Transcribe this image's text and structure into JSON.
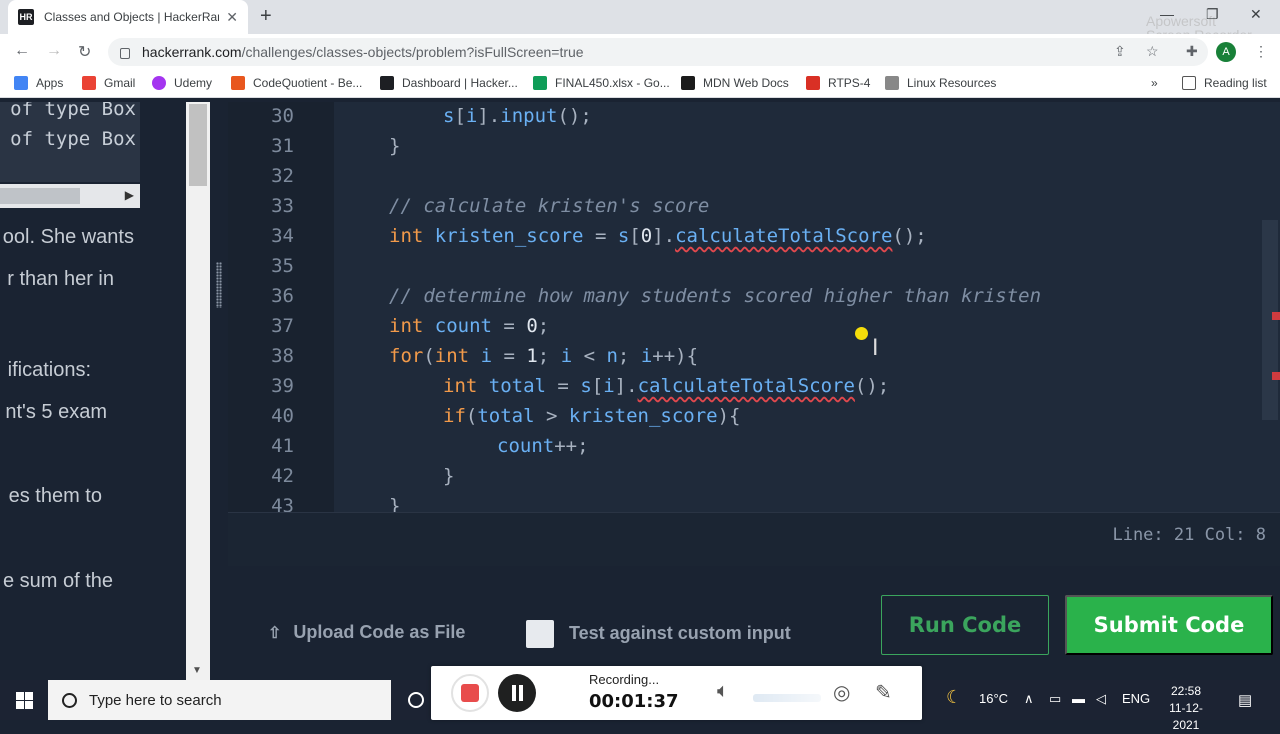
{
  "browser": {
    "tab_title": "Classes and Objects | HackerRank",
    "tab_favicon": "HR",
    "url_host": "hackerrank.com",
    "url_path": "/challenges/classes-objects/problem?isFullScreen=true",
    "avatar_letter": "A",
    "bookmarks": [
      {
        "label": "Apps",
        "icon": "apps-grid-icon",
        "color": "#4285f4"
      },
      {
        "label": "Gmail",
        "icon": "gmail-icon",
        "color": "#ea4335"
      },
      {
        "label": "Udemy",
        "icon": "udemy-icon",
        "color": "#a435f0"
      },
      {
        "label": "CodeQuotient - Be...",
        "icon": "codequotient-icon",
        "color": "#e8571e"
      },
      {
        "label": "Dashboard | Hacker...",
        "icon": "hackerrank-icon",
        "color": "#1d1f23"
      },
      {
        "label": "FINAL450.xlsx - Go...",
        "icon": "google-drive-icon",
        "color": "#0f9d58"
      },
      {
        "label": "MDN Web Docs",
        "icon": "mdn-icon",
        "color": "#1b1b1b"
      },
      {
        "label": "RTPS-4",
        "icon": "rtps-icon",
        "color": "#d93025"
      },
      {
        "label": "Linux Resources",
        "icon": "linux-icon",
        "color": "#888888"
      }
    ],
    "more_bookmarks": "»",
    "reading_list": "Reading list"
  },
  "problem": {
    "code_lines": [
      "l of type Box",
      " of type Box"
    ],
    "desc_lines": [
      "ool. She wants",
      "r than her in",
      "ifications:",
      "nt's 5 exam",
      "es them to",
      "e sum of the"
    ]
  },
  "editor": {
    "lines": [
      {
        "n": "30",
        "indent": 2,
        "tokens": [
          [
            "id",
            "s"
          ],
          [
            "p",
            "["
          ],
          [
            "id",
            "i"
          ],
          [
            "p",
            "]."
          ],
          [
            "id",
            "input"
          ],
          [
            "p",
            "();"
          ]
        ]
      },
      {
        "n": "31",
        "indent": 1,
        "tokens": [
          [
            "p",
            "}"
          ]
        ]
      },
      {
        "n": "32",
        "indent": 0,
        "tokens": []
      },
      {
        "n": "33",
        "indent": 1,
        "tokens": [
          [
            "cmt",
            "// calculate kristen's score"
          ]
        ]
      },
      {
        "n": "34",
        "indent": 1,
        "tokens": [
          [
            "kw",
            "int"
          ],
          [
            "p",
            " "
          ],
          [
            "id",
            "kristen_score"
          ],
          [
            "p",
            " = "
          ],
          [
            "id",
            "s"
          ],
          [
            "p",
            "["
          ],
          [
            "num",
            "0"
          ],
          [
            "p",
            "]."
          ],
          [
            "sq",
            "calculateTotalScore"
          ],
          [
            "p",
            "();"
          ]
        ]
      },
      {
        "n": "35",
        "indent": 0,
        "tokens": []
      },
      {
        "n": "36",
        "indent": 1,
        "tokens": [
          [
            "cmt",
            "// determine how many students scored higher than kristen"
          ]
        ]
      },
      {
        "n": "37",
        "indent": 1,
        "tokens": [
          [
            "kw",
            "int"
          ],
          [
            "p",
            " "
          ],
          [
            "id",
            "count"
          ],
          [
            "p",
            " = "
          ],
          [
            "num",
            "0"
          ],
          [
            "p",
            ";"
          ]
        ]
      },
      {
        "n": "38",
        "indent": 1,
        "tokens": [
          [
            "kw",
            "for"
          ],
          [
            "p",
            "("
          ],
          [
            "kw",
            "int"
          ],
          [
            "p",
            " "
          ],
          [
            "id",
            "i"
          ],
          [
            "p",
            " = "
          ],
          [
            "num",
            "1"
          ],
          [
            "p",
            "; "
          ],
          [
            "id",
            "i"
          ],
          [
            "p",
            " < "
          ],
          [
            "id",
            "n"
          ],
          [
            "p",
            "; "
          ],
          [
            "id",
            "i"
          ],
          [
            "p",
            "++){"
          ]
        ]
      },
      {
        "n": "39",
        "indent": 2,
        "tokens": [
          [
            "kw",
            "int"
          ],
          [
            "p",
            " "
          ],
          [
            "id",
            "total"
          ],
          [
            "p",
            " = "
          ],
          [
            "id",
            "s"
          ],
          [
            "p",
            "["
          ],
          [
            "id",
            "i"
          ],
          [
            "p",
            "]."
          ],
          [
            "sq",
            "calculateTotalScore"
          ],
          [
            "p",
            "();"
          ]
        ]
      },
      {
        "n": "40",
        "indent": 2,
        "tokens": [
          [
            "kw",
            "if"
          ],
          [
            "p",
            "("
          ],
          [
            "id",
            "total"
          ],
          [
            "p",
            " > "
          ],
          [
            "id",
            "kristen_score"
          ],
          [
            "p",
            "){"
          ]
        ]
      },
      {
        "n": "41",
        "indent": 3,
        "tokens": [
          [
            "id",
            "count"
          ],
          [
            "p",
            "++;"
          ]
        ]
      },
      {
        "n": "42",
        "indent": 2,
        "tokens": [
          [
            "p",
            "}"
          ]
        ]
      },
      {
        "n": "43",
        "indent": 1,
        "tokens": [
          [
            "p",
            "}"
          ]
        ]
      }
    ],
    "status": "Line: 21 Col: 8"
  },
  "actions": {
    "upload_label": "Upload Code as File",
    "custom_input_label": "Test against custom input",
    "run_label": "Run Code",
    "submit_label": "Submit Code"
  },
  "recorder": {
    "status": "Recording...",
    "time": "00:01:37",
    "watermark_line1": "Apowersoft",
    "watermark_line2": "Screen Recorder"
  },
  "taskbar": {
    "search_placeholder": "Type here to search",
    "temperature": "16°C",
    "language": "ENG",
    "time": "22:58",
    "date": "11-12-2021"
  }
}
